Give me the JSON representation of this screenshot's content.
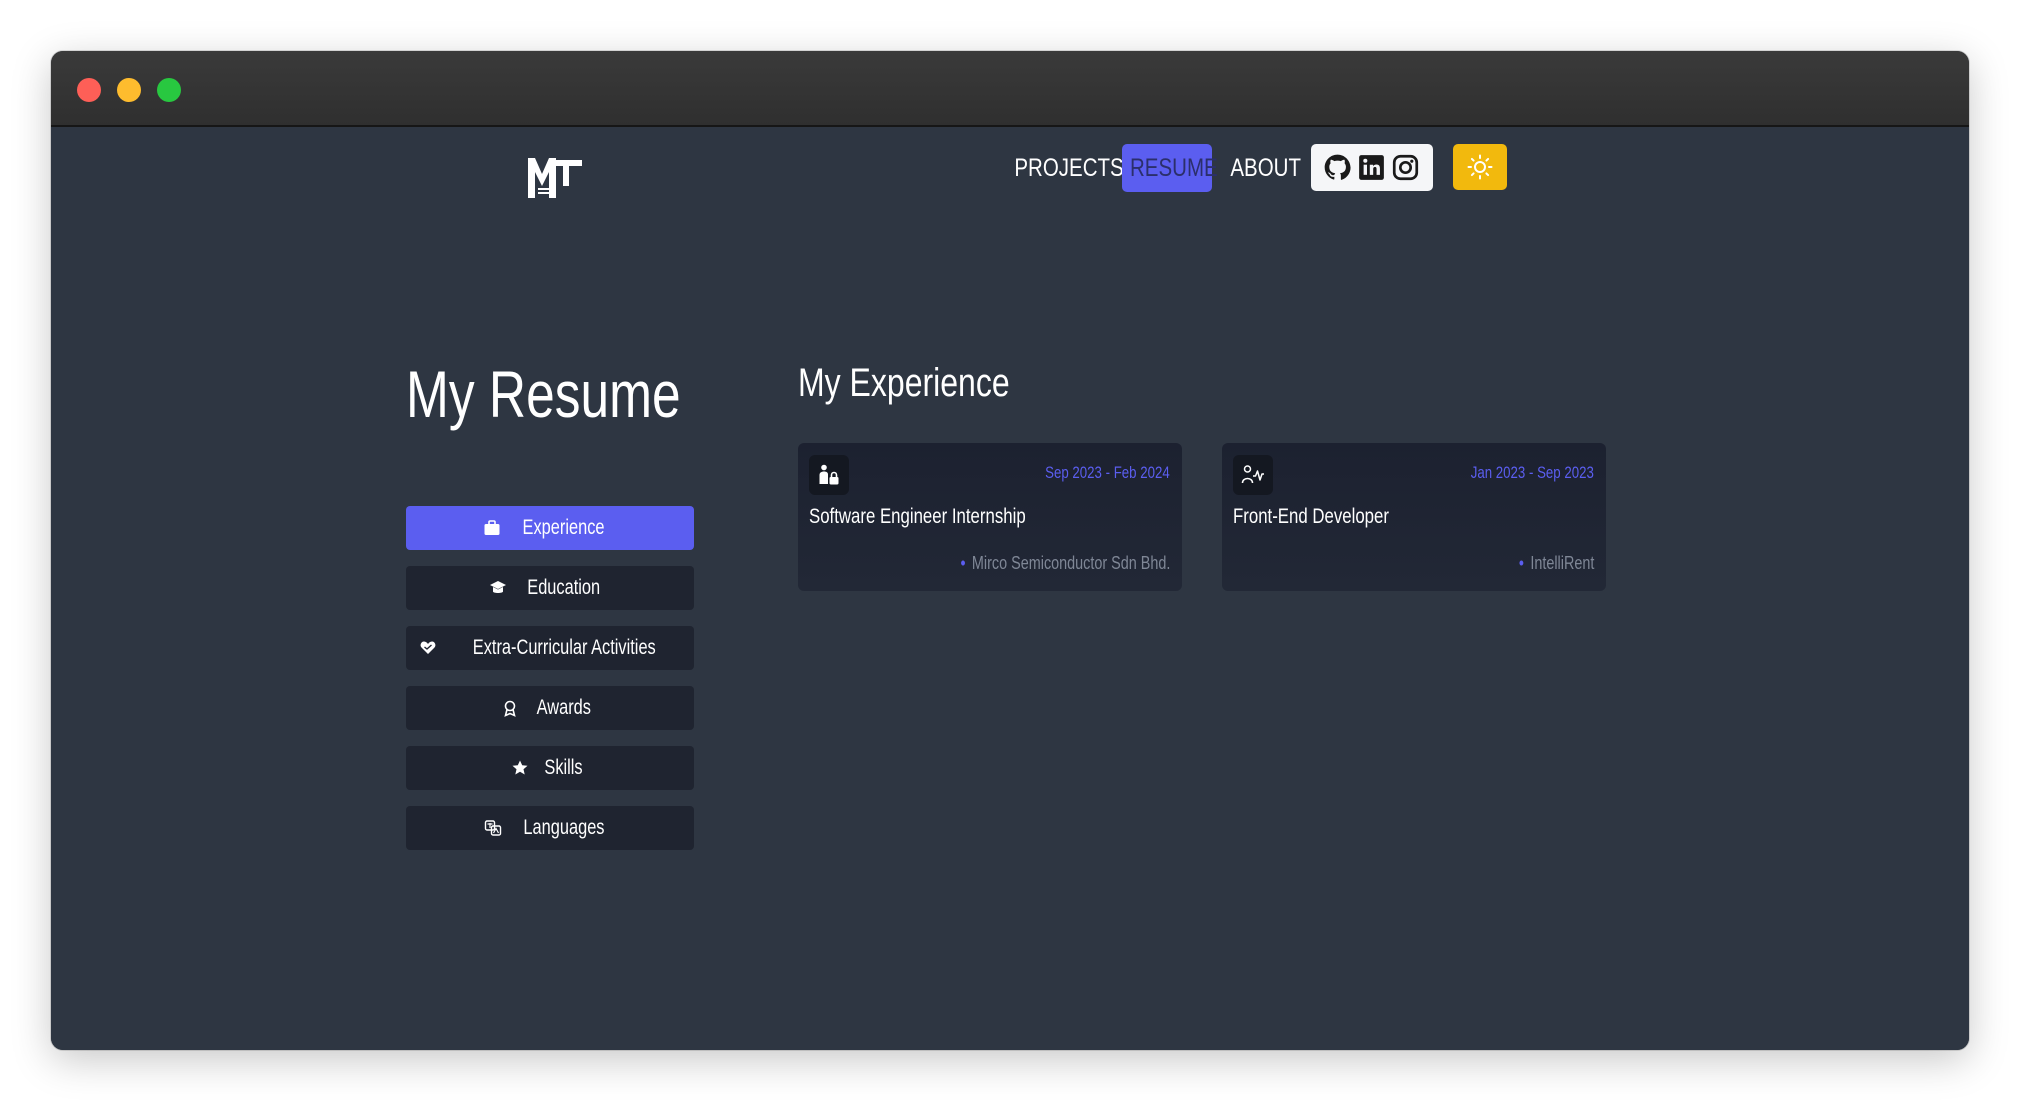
{
  "window": {
    "controls": [
      "close",
      "minimize",
      "maximize"
    ]
  },
  "nav": {
    "logo_icon": "mt-logo",
    "links": [
      {
        "label": "PROJECTS"
      },
      {
        "label": "RESUME",
        "active": true
      },
      {
        "label": "ABOUT"
      }
    ],
    "social_icons": [
      "github-icon",
      "linkedin-icon",
      "instagram-icon"
    ],
    "theme_icon": "sun-icon"
  },
  "resume": {
    "title": "My Resume",
    "sections": [
      {
        "label": "Experience",
        "icon": "briefcase-icon",
        "active": true
      },
      {
        "label": "Education",
        "icon": "graduation-cap-icon"
      },
      {
        "label": "Extra-Curricular Activities",
        "icon": "hand-heart-icon"
      },
      {
        "label": "Awards",
        "icon": "award-icon"
      },
      {
        "label": "Skills",
        "icon": "star-icon"
      },
      {
        "label": "Languages",
        "icon": "languages-icon"
      }
    ]
  },
  "experience": {
    "title": "My Experience",
    "items": [
      {
        "date": "Sep 2023 - Feb 2024",
        "role": "Software Engineer Internship",
        "company": "Mirco Semiconductor Sdn Bhd.",
        "icon": "person-lock-icon"
      },
      {
        "date": "Jan 2023 - Sep 2023",
        "role": "Front-End Developer",
        "company": "IntelliRent",
        "icon": "person-activity-icon"
      }
    ]
  },
  "colors": {
    "accent": "#5b5ef0",
    "background": "#2e3642",
    "button_dark": "#1f2430",
    "theme_button": "#f2b90d"
  }
}
